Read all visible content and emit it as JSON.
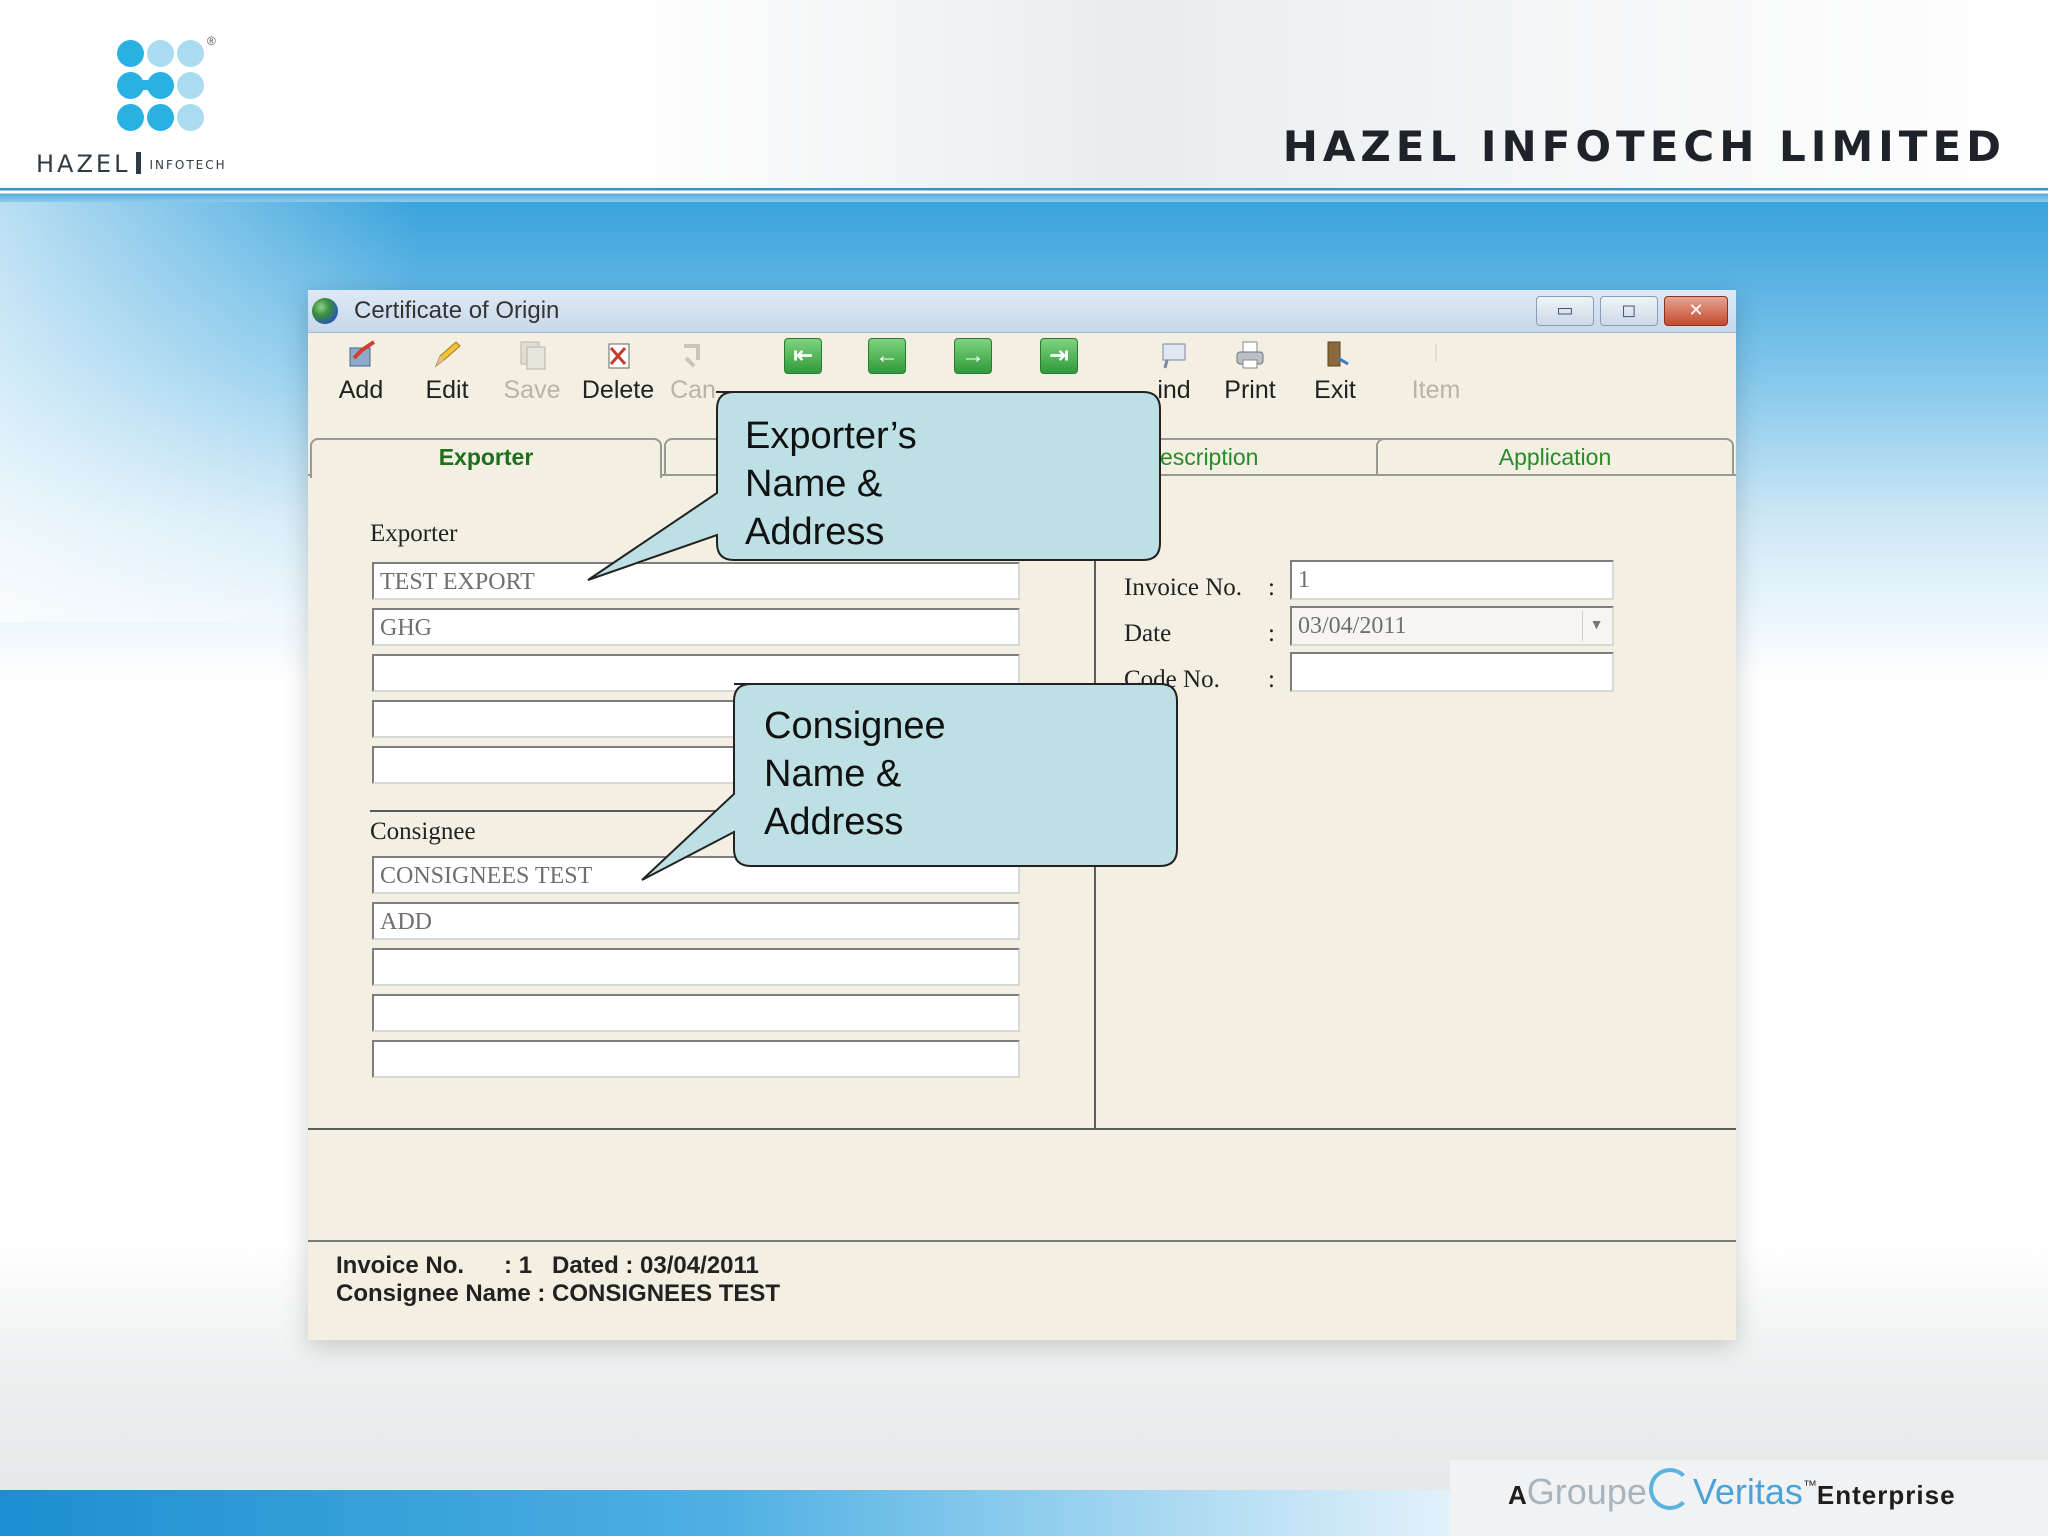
{
  "slide": {
    "logo_text": "HAZEL",
    "logo_subtext": "INFOTECH",
    "logo_registered": "®",
    "company_name": "HAZEL INFOTECH LIMITED",
    "footer": {
      "prefix": "A",
      "groupe": "Groupe",
      "veritas": "Veritas",
      "tm": "™",
      "suffix": "Enterprise"
    }
  },
  "window": {
    "title": "Certificate of Origin",
    "controls": {
      "minimize": "▭",
      "maximize": "◻",
      "close": "✕"
    }
  },
  "toolbar": {
    "add": "Add",
    "edit": "Edit",
    "save": "Save",
    "delete": "Delete",
    "cancel": "Can",
    "first_icon": "⇤",
    "prev_icon": "←",
    "next_icon": "→",
    "last_icon": "⇥",
    "find": "ind",
    "print": "Print",
    "exit": "Exit",
    "item": "Item"
  },
  "tabs": {
    "exporter": "Exporter",
    "description": "escription",
    "application": "Application"
  },
  "exporter_section": {
    "label": "Exporter",
    "lines": [
      "TEST EXPORT",
      "GHG",
      "",
      "",
      ""
    ]
  },
  "consignee_section": {
    "label": "Consignee",
    "lines": [
      "CONSIGNEES TEST",
      "ADD",
      "",
      "",
      ""
    ]
  },
  "invoice_panel": {
    "invoice_no_label": "Invoice No.",
    "invoice_no_value": "1",
    "date_label": "Date",
    "date_value": "03/04/2011",
    "code_no_label": "Code No.",
    "code_no_value": "",
    "colon": ":"
  },
  "status": {
    "line1": "Invoice No.      : 1   Dated : 03/04/2011",
    "line2": "Consignee Name : CONSIGNEES TEST"
  },
  "callouts": {
    "exporter": "Exporter’s Name &\nAddress",
    "consignee": "Consignee Name &\nAddress"
  },
  "colors": {
    "accent_blue": "#2ab1e3",
    "window_bg": "#f3efe2",
    "callout_fill": "#bde0e4",
    "tab_text": "#2a8a2a"
  }
}
